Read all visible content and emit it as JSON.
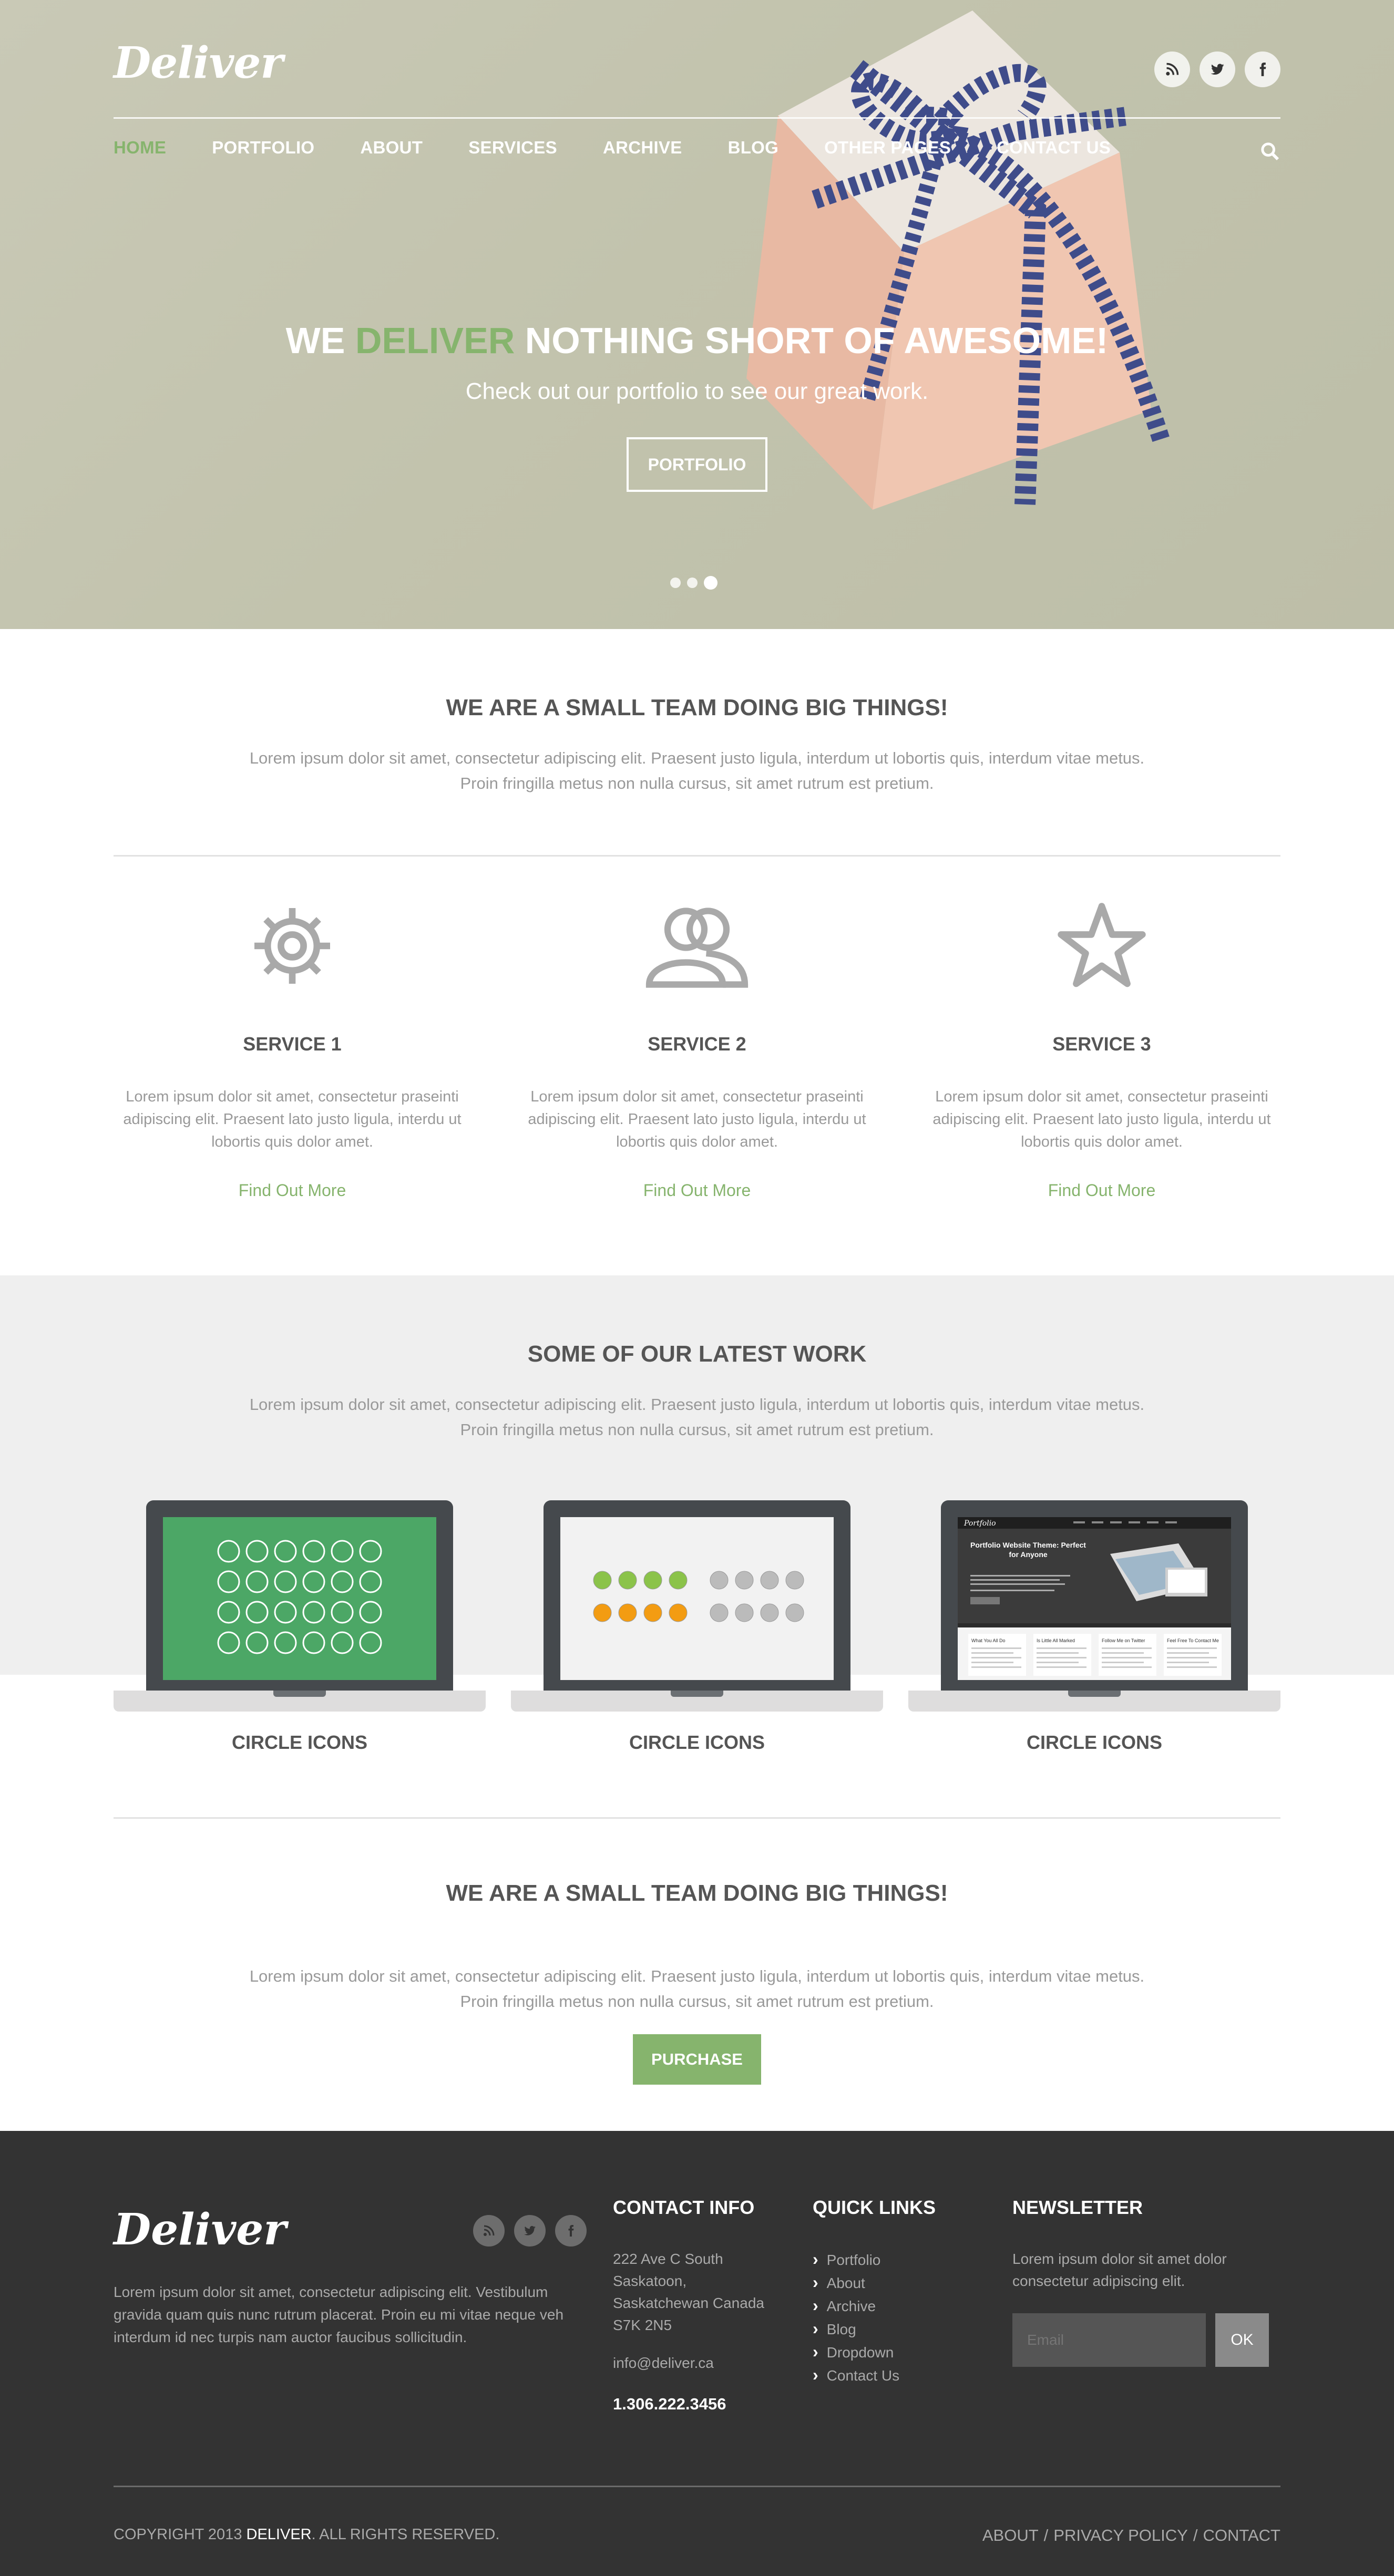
{
  "brand": {
    "name": "Deliver",
    "accent_color": "#86b46d"
  },
  "header": {
    "social_icons": [
      "rss-icon",
      "twitter-icon",
      "facebook-icon"
    ],
    "nav": [
      "HOME",
      "PORTFOLIO",
      "ABOUT",
      "SERVICES",
      "ARCHIVE",
      "BLOG",
      "OTHER PAGES",
      "CONTACT US"
    ],
    "active_nav": "HOME"
  },
  "hero": {
    "headline_pre": "WE ",
    "headline_accent": "DELIVER",
    "headline_post": " NOTHING SHORT OF AWESOME!",
    "subtitle": "Check out our portfolio to see our great work.",
    "button": "PORTFOLIO",
    "slides": 3,
    "active_slide": 3
  },
  "intro": {
    "title": "WE ARE A SMALL TEAM DOING BIG THINGS!",
    "text": "Lorem ipsum dolor sit amet, consectetur adipiscing elit. Praesent justo ligula, interdum ut lobortis quis, interdum vitae metus. Proin fringilla metus non nulla cursus, sit amet rutrum est pretium."
  },
  "services": [
    {
      "icon": "gear-icon",
      "title": "SERVICE 1",
      "text": "Lorem ipsum dolor sit amet, consectetur praseinti adipiscing elit. Praesent lato justo ligula, interdu ut lobortis quis dolor amet.",
      "link": "Find Out More"
    },
    {
      "icon": "users-icon",
      "title": "SERVICE 2",
      "text": "Lorem ipsum dolor sit amet, consectetur praseinti adipiscing elit. Praesent lato justo ligula, interdu ut lobortis quis dolor amet.",
      "link": "Find Out More"
    },
    {
      "icon": "star-icon",
      "title": "SERVICE 3",
      "text": "Lorem ipsum dolor sit amet, consectetur praseinti adipiscing elit. Praesent lato justo ligula, interdu ut lobortis quis dolor amet.",
      "link": "Find Out More"
    }
  ],
  "work": {
    "title": "SOME OF OUR LATEST WORK",
    "text": "Lorem ipsum dolor sit amet, consectetur adipiscing elit. Praesent justo ligula, interdum ut lobortis quis, interdum vitae metus. Proin fringilla metus non nulla cursus, sit amet rutrum est pretium.",
    "items": [
      {
        "title": "CIRCLE ICONS"
      },
      {
        "title": "CIRCLE ICONS"
      },
      {
        "title": "CIRCLE ICONS"
      }
    ],
    "preview_portfolio": {
      "logo": "Portfolio",
      "headline": "Portfolio Website Theme: Perfect for Anyone",
      "cols": [
        "What You All Do",
        "Is Little All Marked",
        "Follow Me on Twitter",
        "Feel Free To Contact Me"
      ]
    }
  },
  "cta": {
    "title": "WE ARE A SMALL TEAM DOING BIG THINGS!",
    "text": "Lorem ipsum dolor sit amet, consectetur adipiscing elit. Praesent justo ligula, interdum ut lobortis quis, interdum vitae metus. Proin fringilla metus non nulla cursus, sit amet rutrum est pretium.",
    "button": "PURCHASE"
  },
  "footer": {
    "about": "Lorem ipsum dolor sit amet, consectetur adipiscing elit. Vestibulum gravida quam quis nunc rutrum placerat. Proin eu mi vitae neque veh interdum id nec turpis nam auctor faucibus sollicitudin.",
    "contact": {
      "title": "CONTACT INFO",
      "address": [
        "222 Ave C South",
        "Saskatoon,",
        "Saskatchewan Canada",
        "S7K 2N5"
      ],
      "email": "info@deliver.ca",
      "phone": "1.306.222.3456"
    },
    "quick_links": {
      "title": "QUICK LINKS",
      "items": [
        "Portfolio",
        "About",
        "Archive",
        "Blog",
        "Dropdown",
        "Contact Us"
      ]
    },
    "newsletter": {
      "title": "NEWSLETTER",
      "text": "Lorem ipsum dolor sit amet dolor consectetur adipiscing elit.",
      "placeholder": "Email",
      "button": "OK"
    },
    "copyright_pre": "COPYRIGHT 2013 ",
    "copyright_brand": "DELIVER",
    "copyright_post": ". ALL RIGHTS RESERVED.",
    "bottom_links": [
      "ABOUT",
      "PRIVACY POLICY",
      "CONTACT"
    ]
  }
}
